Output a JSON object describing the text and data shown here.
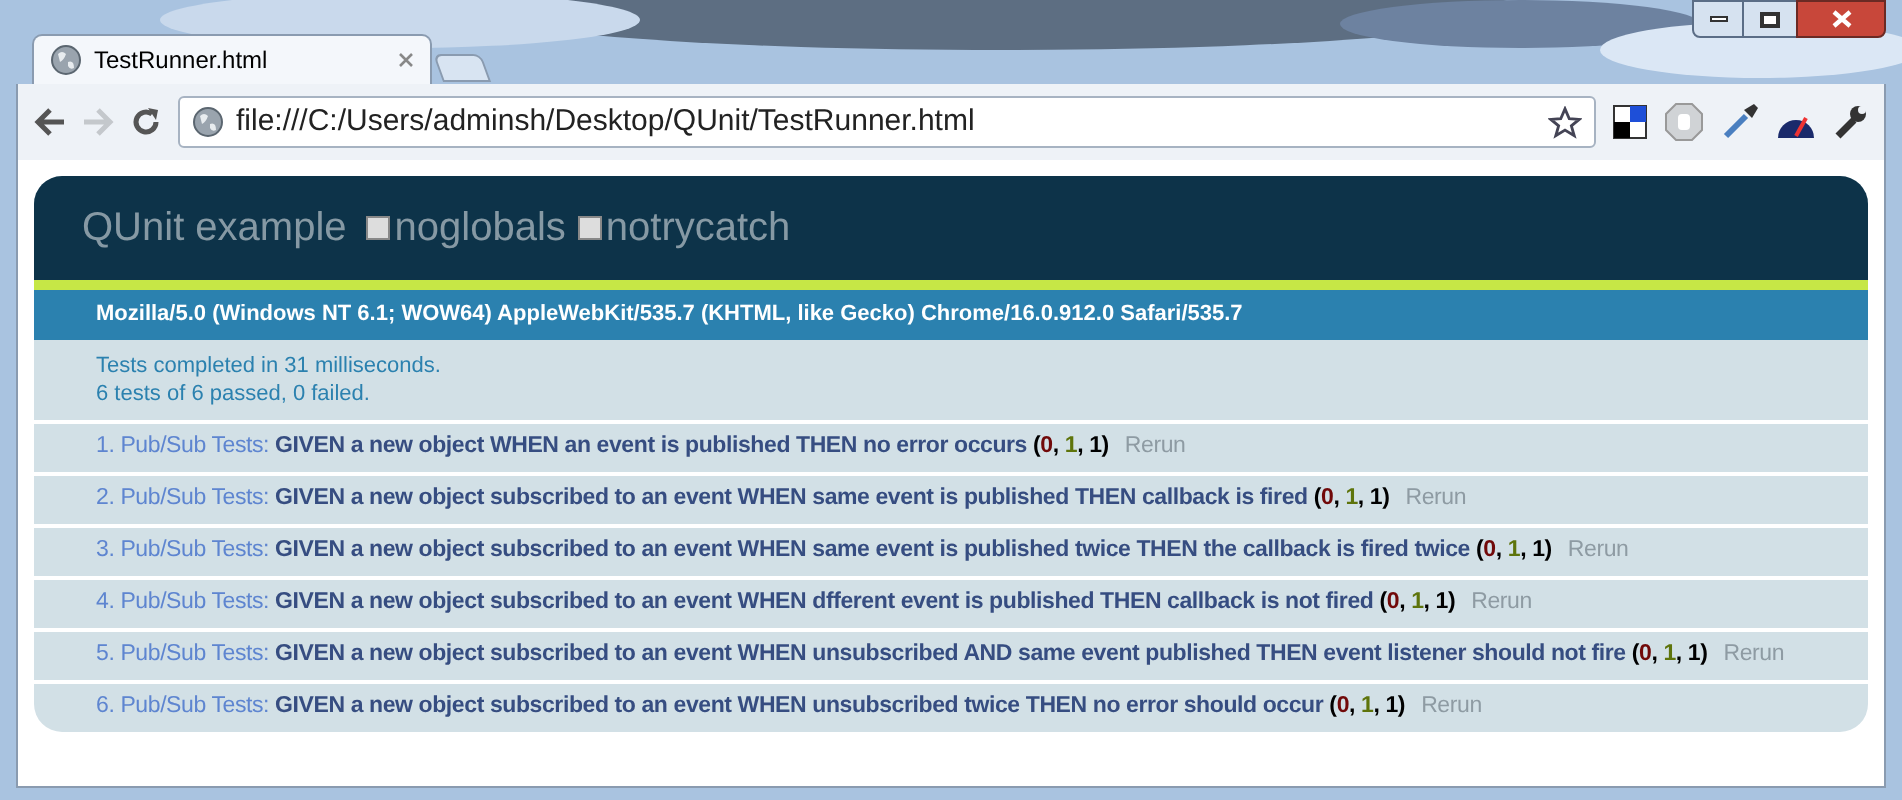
{
  "browser": {
    "tab_title": "TestRunner.html",
    "address": "file:///C:/Users/adminsh/Desktop/QUnit/TestRunner.html",
    "forward_disabled": true
  },
  "header": {
    "title": "QUnit example",
    "options": [
      {
        "label": "noglobals",
        "checked": false
      },
      {
        "label": "notrycatch",
        "checked": false
      }
    ]
  },
  "user_agent": "Mozilla/5.0 (Windows NT 6.1; WOW64) AppleWebKit/535.7 (KHTML, like Gecko) Chrome/16.0.912.0 Safari/535.7",
  "result": [
    "Tests completed in 31 milliseconds.",
    "6 tests of 6 passed, 0 failed."
  ],
  "tests": [
    {
      "number": "1.",
      "module": "Pub/Sub Tests:",
      "name": "GIVEN a new object WHEN an event is published THEN no error occurs",
      "counts": [
        {
          "kind": "punct",
          "text": "("
        },
        {
          "kind": "failed",
          "text": "0"
        },
        {
          "kind": "punct",
          "text": ", "
        },
        {
          "kind": "passed",
          "text": "1"
        },
        {
          "kind": "punct",
          "text": ", "
        },
        {
          "kind": "total",
          "text": "1"
        },
        {
          "kind": "punct",
          "text": ")"
        }
      ],
      "rerun": "Rerun"
    },
    {
      "number": "2.",
      "module": "Pub/Sub Tests:",
      "name": "GIVEN a new object subscribed to an event WHEN same event is published THEN callback is fired",
      "counts": [
        {
          "kind": "punct",
          "text": "("
        },
        {
          "kind": "failed",
          "text": "0"
        },
        {
          "kind": "punct",
          "text": ", "
        },
        {
          "kind": "passed",
          "text": "1"
        },
        {
          "kind": "punct",
          "text": ", "
        },
        {
          "kind": "total",
          "text": "1"
        },
        {
          "kind": "punct",
          "text": ")"
        }
      ],
      "rerun": "Rerun"
    },
    {
      "number": "3.",
      "module": "Pub/Sub Tests:",
      "name": "GIVEN a new object subscribed to an event WHEN same event is published twice THEN the callback is fired twice",
      "counts": [
        {
          "kind": "punct",
          "text": "("
        },
        {
          "kind": "failed",
          "text": "0"
        },
        {
          "kind": "punct",
          "text": ", "
        },
        {
          "kind": "passed",
          "text": "1"
        },
        {
          "kind": "punct",
          "text": ", "
        },
        {
          "kind": "total",
          "text": "1"
        },
        {
          "kind": "punct",
          "text": ")"
        }
      ],
      "rerun": "Rerun"
    },
    {
      "number": "4.",
      "module": "Pub/Sub Tests:",
      "name": "GIVEN a new object subscribed to an event WHEN dfferent event is published THEN callback is not fired",
      "counts": [
        {
          "kind": "punct",
          "text": "("
        },
        {
          "kind": "failed",
          "text": "0"
        },
        {
          "kind": "punct",
          "text": ", "
        },
        {
          "kind": "passed",
          "text": "1"
        },
        {
          "kind": "punct",
          "text": ", "
        },
        {
          "kind": "total",
          "text": "1"
        },
        {
          "kind": "punct",
          "text": ")"
        }
      ],
      "rerun": "Rerun"
    },
    {
      "number": "5.",
      "module": "Pub/Sub Tests:",
      "name": "GIVEN a new object subscribed to an event WHEN unsubscribed AND same event published THEN event listener should not fire",
      "counts": [
        {
          "kind": "punct",
          "text": "("
        },
        {
          "kind": "failed",
          "text": "0"
        },
        {
          "kind": "punct",
          "text": ", "
        },
        {
          "kind": "passed",
          "text": "1"
        },
        {
          "kind": "punct",
          "text": ", "
        },
        {
          "kind": "total",
          "text": "1"
        },
        {
          "kind": "punct",
          "text": ")"
        }
      ],
      "rerun": "Rerun"
    },
    {
      "number": "6.",
      "module": "Pub/Sub Tests:",
      "name": "GIVEN a new object subscribed to an event WHEN unsubscribed twice THEN no error should occur",
      "counts": [
        {
          "kind": "punct",
          "text": "("
        },
        {
          "kind": "failed",
          "text": "0"
        },
        {
          "kind": "punct",
          "text": ", "
        },
        {
          "kind": "passed",
          "text": "1"
        },
        {
          "kind": "punct",
          "text": ", "
        },
        {
          "kind": "total",
          "text": "1"
        },
        {
          "kind": "punct",
          "text": ")"
        }
      ],
      "rerun": "Rerun"
    }
  ]
}
